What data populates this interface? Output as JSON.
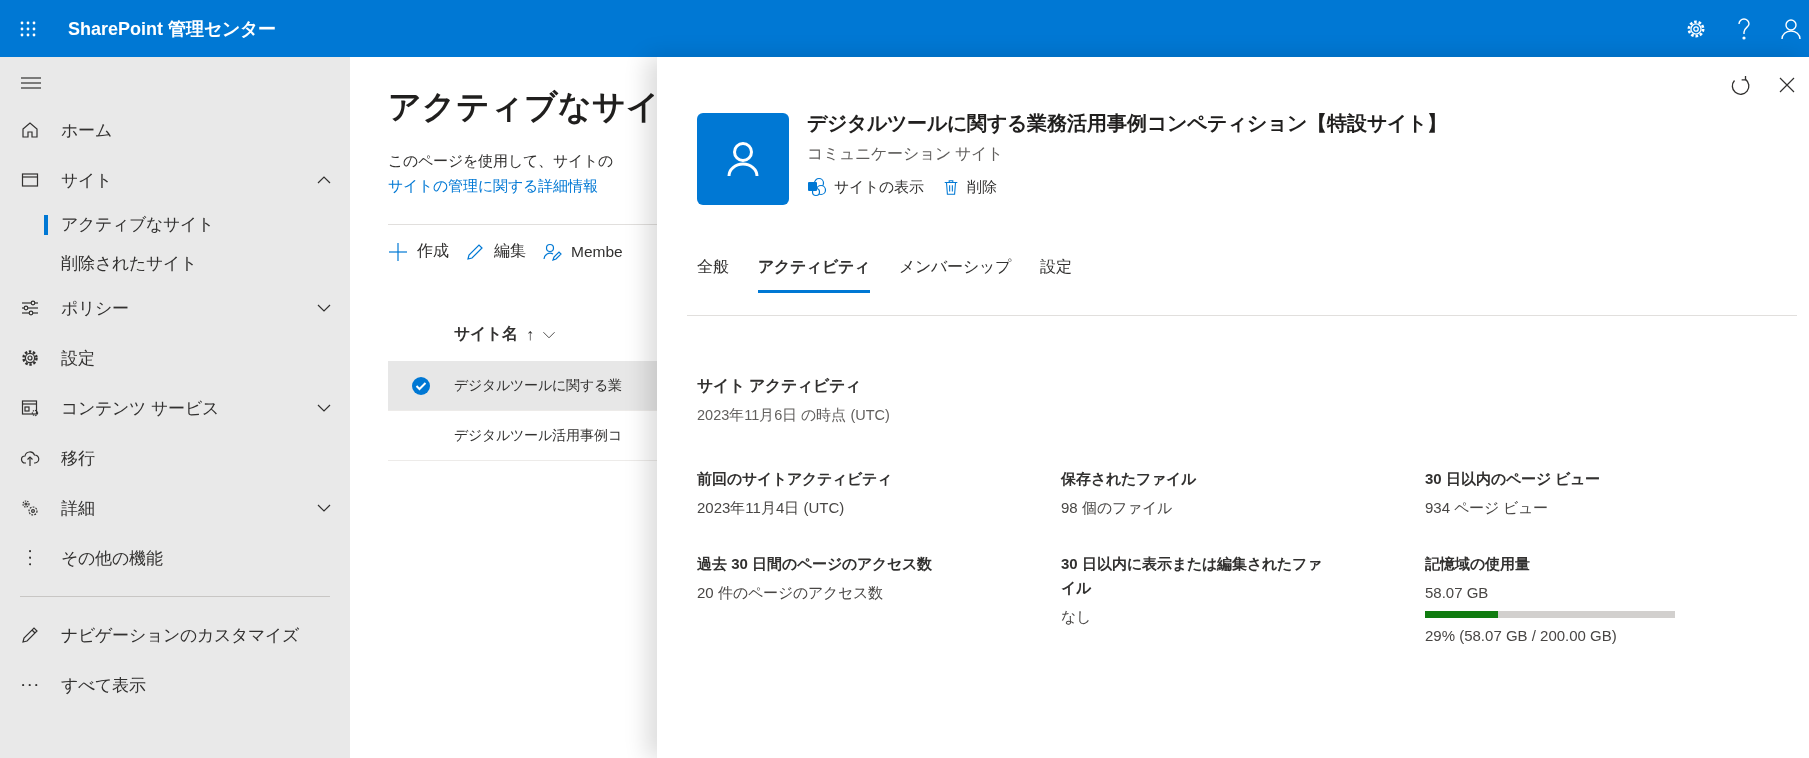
{
  "header": {
    "title": "SharePoint 管理センター"
  },
  "nav": {
    "items": [
      {
        "label": "ホーム"
      },
      {
        "label": "サイト",
        "expanded": true,
        "children": [
          {
            "label": "アクティブなサイト",
            "selected": true
          },
          {
            "label": "削除されたサイト",
            "selected": false
          }
        ]
      },
      {
        "label": "ポリシー",
        "expanded": false
      },
      {
        "label": "設定"
      },
      {
        "label": "コンテンツ サービス",
        "expanded": false
      },
      {
        "label": "移行"
      },
      {
        "label": "詳細",
        "expanded": false
      },
      {
        "label": "その他の機能"
      }
    ],
    "footer_items": [
      {
        "label": "ナビゲーションのカスタマイズ"
      },
      {
        "label": "すべて表示"
      }
    ]
  },
  "main": {
    "title": "アクティブなサイ",
    "description": "このページを使用して、サイトの",
    "link": "サイトの管理に関する詳細情報",
    "toolbar": [
      "作成",
      "編集",
      "Membe"
    ],
    "table": {
      "column": "サイト名",
      "sort": "↑",
      "rows": [
        {
          "name": "デジタルツールに関する業",
          "selected": true
        },
        {
          "name": "デジタルツール活用事例コ",
          "selected": false
        }
      ]
    }
  },
  "panel": {
    "site_title": "デジタルツールに関する業務活用事例コンペティション【特設サイト】",
    "site_type": "コミュニケーション サイト",
    "actions": [
      "サイトの表示",
      "削除"
    ],
    "tabs": [
      {
        "label": "全般",
        "selected": false
      },
      {
        "label": "アクティビティ",
        "selected": true
      },
      {
        "label": "メンバーシップ",
        "selected": false
      },
      {
        "label": "設定",
        "selected": false
      }
    ],
    "section_title": "サイト アクティビティ",
    "as_of": "2023年11月6日 の時点 (UTC)",
    "stats": [
      {
        "kind": "text",
        "label": "前回のサイトアクティビティ",
        "value": "2023年11月4日 (UTC)"
      },
      {
        "kind": "text",
        "label": "保存されたファイル",
        "value": "98 個のファイル"
      },
      {
        "kind": "text",
        "label": "30 日以内のページ ビュー",
        "value": "934 ページ ビュー"
      },
      {
        "kind": "text",
        "label": "過去 30 日間のページのアクセス数",
        "value": "20 件のページのアクセス数"
      },
      {
        "kind": "text",
        "label": "30 日以内に表示または編集されたファイル",
        "value": "なし"
      },
      {
        "kind": "meter",
        "label": "記憶域の使用量",
        "value": "58.07 GB",
        "level": 0.29,
        "reading": "29% (58.07 GB / 200.00 GB)"
      }
    ]
  }
}
